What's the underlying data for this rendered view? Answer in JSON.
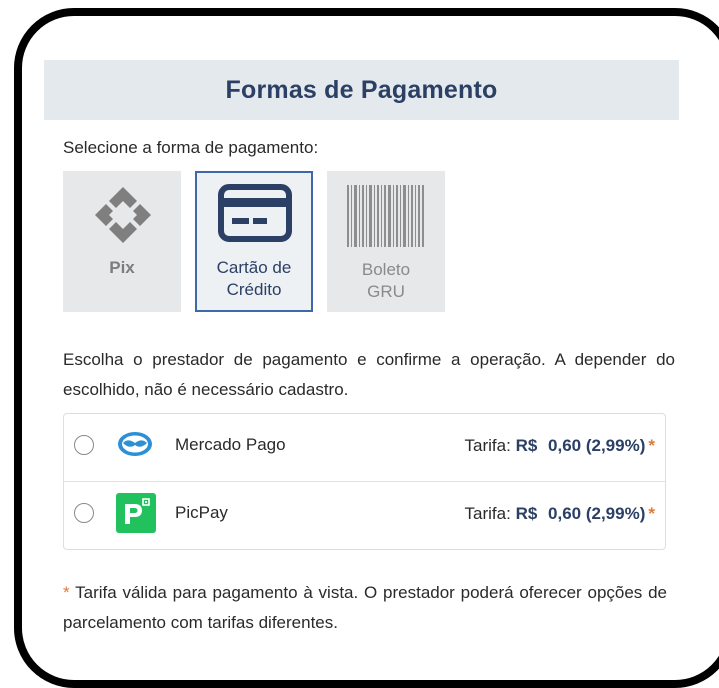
{
  "header": {
    "title": "Formas de Pagamento"
  },
  "instruction": "Selecione a forma de pagamento:",
  "methods": [
    {
      "label": "Pix",
      "icon": "pix-icon",
      "selected": false
    },
    {
      "label_line1": "Cartão de",
      "label_line2": "Crédito",
      "icon": "credit-card-icon",
      "selected": true
    },
    {
      "label_line1": "Boleto",
      "label_line2": "GRU",
      "icon": "barcode-icon",
      "selected": false
    }
  ],
  "provider_intro": "Escolha o prestador de pagamento e confirme a operação. A depender do escolhido, não é necessário cadastro.",
  "providers": [
    {
      "name": "Mercado Pago",
      "icon": "mercado-pago-logo-icon",
      "fee_label": "Tarifa:",
      "currency": "R$",
      "amount": "0,60 (2,99%)",
      "asterisk": "*",
      "selected": false
    },
    {
      "name": "PicPay",
      "icon": "picpay-logo-icon",
      "fee_label": "Tarifa:",
      "currency": "R$",
      "amount": "0,60 (2,99%)",
      "asterisk": "*",
      "selected": false
    }
  ],
  "footnote": {
    "asterisk": "*",
    "text": "Tarifa válida para pagamento à vista. O prestador poderá oferecer opções de parcelamento com tarifas diferentes."
  },
  "colors": {
    "accent": "#2b4064",
    "selected_border": "#3d69a8",
    "header_bg": "#e4e9ed",
    "asterisk": "#e07a3a",
    "picpay": "#21c25e",
    "mercado_pago": "#2d8fd5"
  }
}
